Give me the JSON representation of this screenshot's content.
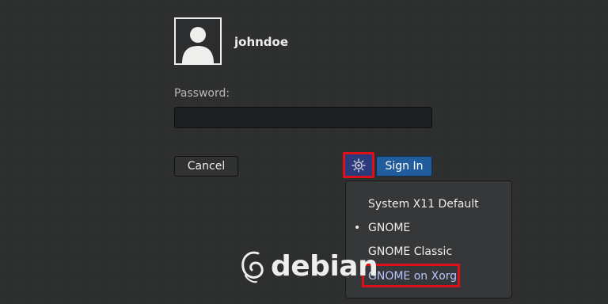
{
  "user": {
    "name": "johndoe"
  },
  "login": {
    "password_label": "Password:",
    "password_value": "",
    "cancel_label": "Cancel",
    "signin_label": "Sign In",
    "session_button_icon": "gear-icon"
  },
  "session_menu": {
    "items": [
      {
        "label": "System X11 Default",
        "selected": false
      },
      {
        "label": "GNOME",
        "selected": true
      },
      {
        "label": "GNOME Classic",
        "selected": false
      },
      {
        "label": "GNOME on Xorg",
        "selected": false
      }
    ],
    "selected_bullet": "•"
  },
  "branding": {
    "logo_text": "debian"
  },
  "colors": {
    "background": "#2b2d2e",
    "signin_button": "#215d9c",
    "highlight_box": "#e0101a",
    "menu_background": "#353739"
  }
}
